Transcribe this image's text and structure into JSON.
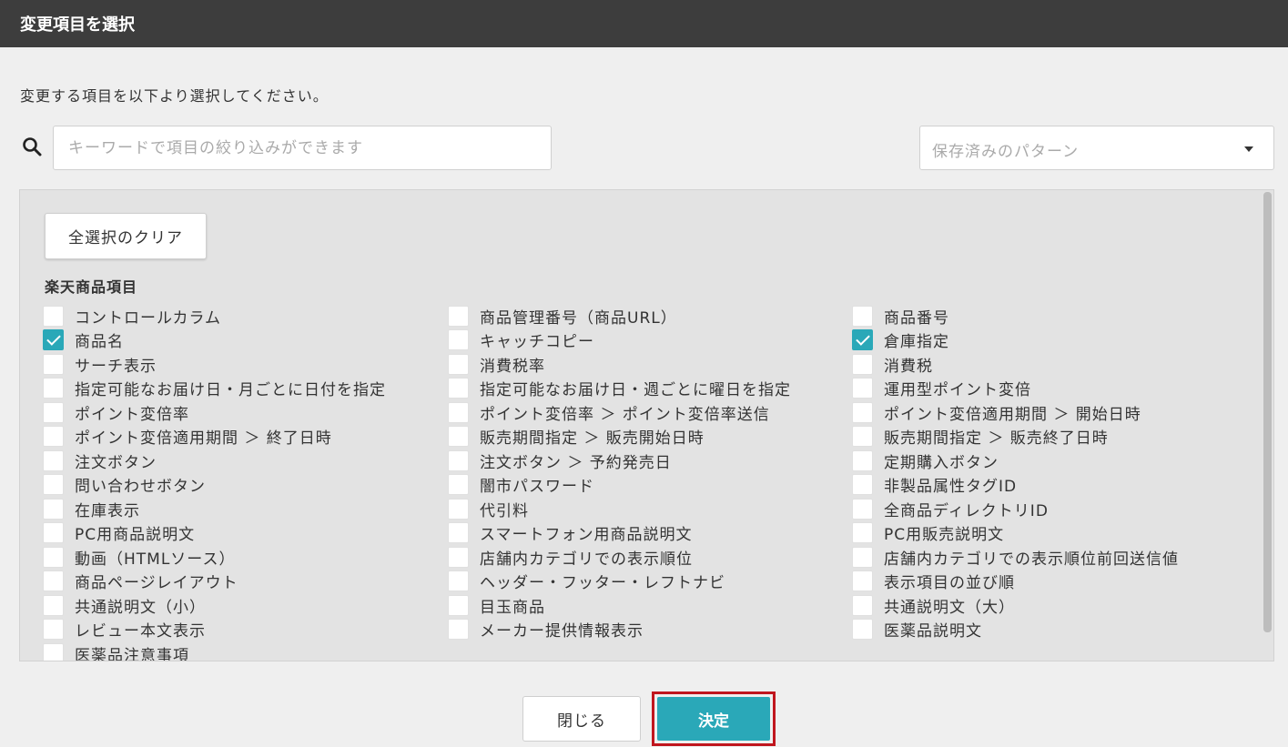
{
  "dialog": {
    "title": "変更項目を選択",
    "instruction": "変更する項目を以下より選択してください。"
  },
  "search": {
    "placeholder": "キーワードで項目の絞り込みができます",
    "value": ""
  },
  "pattern_select": {
    "placeholder": "保存済みのパターン"
  },
  "panel": {
    "clear_label": "全選択のクリア",
    "section_title": "楽天商品項目",
    "columns": [
      [
        {
          "label": "コントロールカラム",
          "checked": false
        },
        {
          "label": "商品名",
          "checked": true
        },
        {
          "label": "サーチ表示",
          "checked": false
        },
        {
          "label": "指定可能なお届け日・月ごとに日付を指定",
          "checked": false
        },
        {
          "label": "ポイント変倍率",
          "checked": false
        },
        {
          "label": "ポイント変倍適用期間 ＞ 終了日時",
          "checked": false
        },
        {
          "label": "注文ボタン",
          "checked": false
        },
        {
          "label": "問い合わせボタン",
          "checked": false
        },
        {
          "label": "在庫表示",
          "checked": false
        },
        {
          "label": "PC用商品説明文",
          "checked": false
        },
        {
          "label": "動画（HTMLソース）",
          "checked": false
        },
        {
          "label": "商品ページレイアウト",
          "checked": false
        },
        {
          "label": "共通説明文（小）",
          "checked": false
        },
        {
          "label": "レビュー本文表示",
          "checked": false
        },
        {
          "label": "医薬品注意事項",
          "checked": false
        }
      ],
      [
        {
          "label": "商品管理番号（商品URL）",
          "checked": false
        },
        {
          "label": "キャッチコピー",
          "checked": false
        },
        {
          "label": "消費税率",
          "checked": false
        },
        {
          "label": "指定可能なお届け日・週ごとに曜日を指定",
          "checked": false
        },
        {
          "label": "ポイント変倍率 ＞ ポイント変倍率送信",
          "checked": false
        },
        {
          "label": "販売期間指定 ＞ 販売開始日時",
          "checked": false
        },
        {
          "label": "注文ボタン ＞ 予約発売日",
          "checked": false
        },
        {
          "label": "闇市パスワード",
          "checked": false
        },
        {
          "label": "代引料",
          "checked": false
        },
        {
          "label": "スマートフォン用商品説明文",
          "checked": false
        },
        {
          "label": "店舗内カテゴリでの表示順位",
          "checked": false
        },
        {
          "label": "ヘッダー・フッター・レフトナビ",
          "checked": false
        },
        {
          "label": "目玉商品",
          "checked": false
        },
        {
          "label": "メーカー提供情報表示",
          "checked": false
        }
      ],
      [
        {
          "label": "商品番号",
          "checked": false
        },
        {
          "label": "倉庫指定",
          "checked": true
        },
        {
          "label": "消費税",
          "checked": false
        },
        {
          "label": "運用型ポイント変倍",
          "checked": false
        },
        {
          "label": "ポイント変倍適用期間 ＞ 開始日時",
          "checked": false
        },
        {
          "label": "販売期間指定 ＞ 販売終了日時",
          "checked": false
        },
        {
          "label": "定期購入ボタン",
          "checked": false
        },
        {
          "label": "非製品属性タグID",
          "checked": false
        },
        {
          "label": "全商品ディレクトリID",
          "checked": false
        },
        {
          "label": "PC用販売説明文",
          "checked": false
        },
        {
          "label": "店舗内カテゴリでの表示順位前回送信値",
          "checked": false
        },
        {
          "label": "表示項目の並び順",
          "checked": false
        },
        {
          "label": "共通説明文（大）",
          "checked": false
        },
        {
          "label": "医薬品説明文",
          "checked": false
        }
      ]
    ]
  },
  "footer": {
    "close_label": "閉じる",
    "confirm_label": "決定"
  },
  "colors": {
    "accent": "#2aa8b8",
    "titlebar": "#3d3d3d",
    "highlight_outline": "#c0161e"
  }
}
